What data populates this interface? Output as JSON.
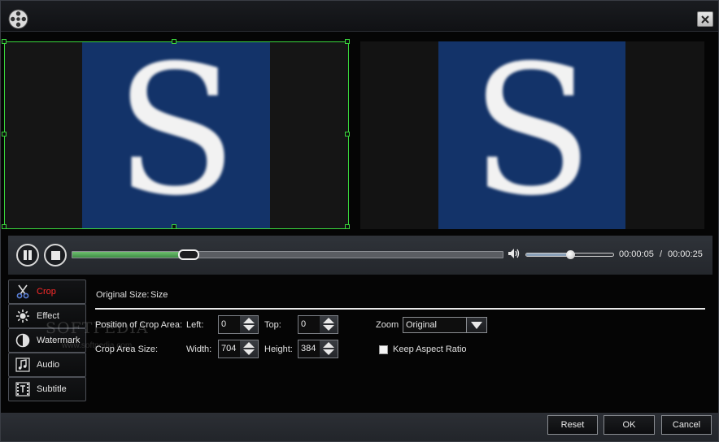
{
  "window": {
    "app_icon": "film-reel-icon",
    "close_icon": "close-icon"
  },
  "playback": {
    "progress_fraction": 0.25,
    "volume_fraction": 0.5,
    "current_time": "00:00:05",
    "separator": "/",
    "total_time": "00:00:25"
  },
  "preview": {
    "source_letter": "S",
    "frame_color": "#133369",
    "crop_border_color": "#39d63c"
  },
  "tabs": [
    {
      "label": "Crop",
      "icon": "scissors-icon",
      "active": true
    },
    {
      "label": "Effect",
      "icon": "sun-icon",
      "active": false
    },
    {
      "label": "Watermark",
      "icon": "half-circle-icon",
      "active": false
    },
    {
      "label": "Audio",
      "icon": "music-note-icon",
      "active": false
    },
    {
      "label": "Subtitle",
      "icon": "film-text-icon",
      "active": false
    }
  ],
  "crop": {
    "original_size_label": "Original Size:",
    "original_size_value": "Size",
    "position_label": "Position of Crop Area:",
    "left_label": "Left:",
    "left_value": "0",
    "top_label": "Top:",
    "top_value": "0",
    "size_label": "Crop Area Size:",
    "width_label": "Width:",
    "width_value": "704",
    "height_label": "Height:",
    "height_value": "384",
    "zoom_label": "Zoom",
    "zoom_value": "Original",
    "keep_aspect_label": "Keep Aspect Ratio",
    "keep_aspect_checked": false
  },
  "watermark": {
    "text": "SOFTPEDIA",
    "sub": "www.softpedia.com"
  },
  "buttons": {
    "reset": "Reset",
    "ok": "OK",
    "cancel": "Cancel"
  },
  "colors": {
    "accent_active_tab": "#ff2a2a",
    "progress_fill": "#4f9f55"
  }
}
